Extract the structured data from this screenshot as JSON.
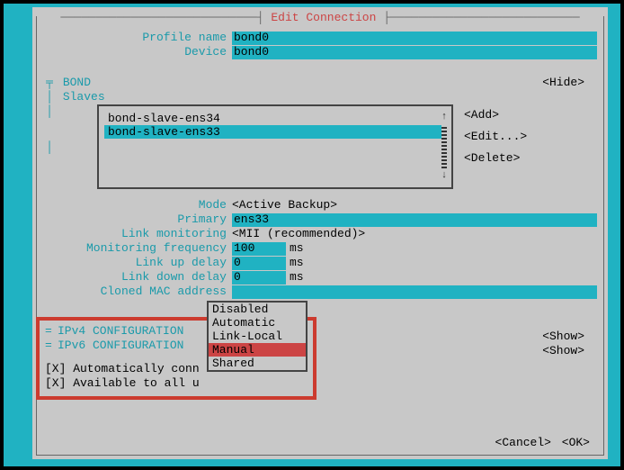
{
  "title": "Edit Connection",
  "labels": {
    "profile_name": "Profile name",
    "device": "Device",
    "mode": "Mode",
    "primary": "Primary",
    "link_monitoring": "Link monitoring",
    "monitoring_frequency": "Monitoring frequency",
    "link_up_delay": "Link up delay",
    "link_down_delay": "Link down delay",
    "cloned_mac": "Cloned MAC address"
  },
  "values": {
    "profile_name": "bond0",
    "device": "bond0",
    "mode": "<Active Backup>",
    "primary": "ens33",
    "link_monitoring": "<MII (recommended)>",
    "monitoring_frequency": "100",
    "link_up_delay": "0",
    "link_down_delay": "0",
    "cloned_mac": "",
    "ms": "ms"
  },
  "bond": {
    "section": "BOND",
    "slaves_label": "Slaves",
    "slaves": [
      "bond-slave-ens34",
      "bond-slave-ens33"
    ],
    "selected_index": 1,
    "buttons": {
      "add": "<Add>",
      "edit": "<Edit...>",
      "delete": "<Delete>"
    },
    "hide": "<Hide>"
  },
  "ipv4": {
    "label": "IPv4 CONFIGURATION",
    "show": "<Show>"
  },
  "ipv6": {
    "label": "IPv6 CONFIGURATION",
    "show": "<Show>"
  },
  "checkboxes": {
    "auto_connect": "[X] Automatically conn",
    "all_users": "[X] Available to all u"
  },
  "popup": {
    "items": [
      "Disabled",
      "Automatic",
      "Link-Local",
      "Manual",
      "Shared"
    ],
    "selected_index": 3
  },
  "footer": {
    "cancel": "<Cancel>",
    "ok": "<OK>"
  }
}
